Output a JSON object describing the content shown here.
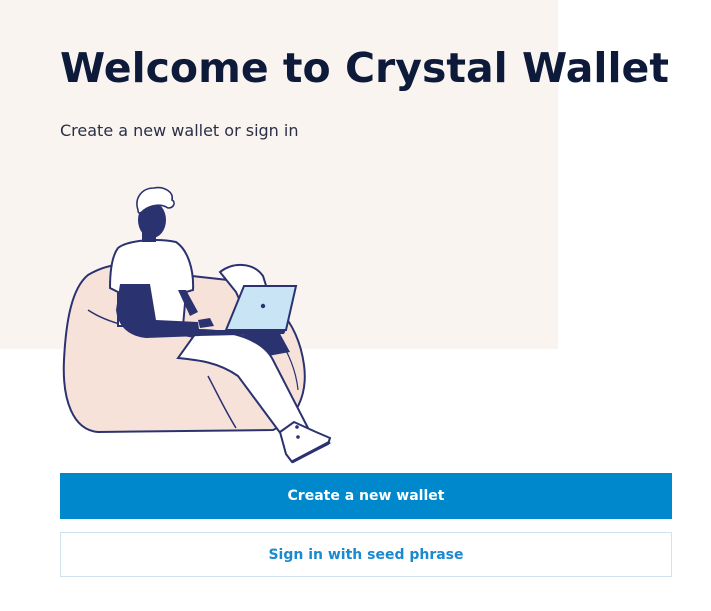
{
  "welcome": {
    "title": "Welcome to Crystal Wallet",
    "subtitle": "Create a new wallet or sign in"
  },
  "actions": {
    "create_label": "Create a new wallet",
    "signin_label": "Sign in with seed phrase"
  },
  "illustration": {
    "icon": "person-on-beanbag-with-laptop-illustration"
  },
  "colors": {
    "hero_background": "#faf4f1",
    "title_text": "#0e1a3a",
    "primary_button": "#0088cc",
    "secondary_button_text": "#1a8ad0",
    "secondary_button_border": "#cfe2ee",
    "beanbag": "#f7e2da",
    "figure_navy": "#2b3270",
    "laptop_screen": "#c9e4f5"
  }
}
